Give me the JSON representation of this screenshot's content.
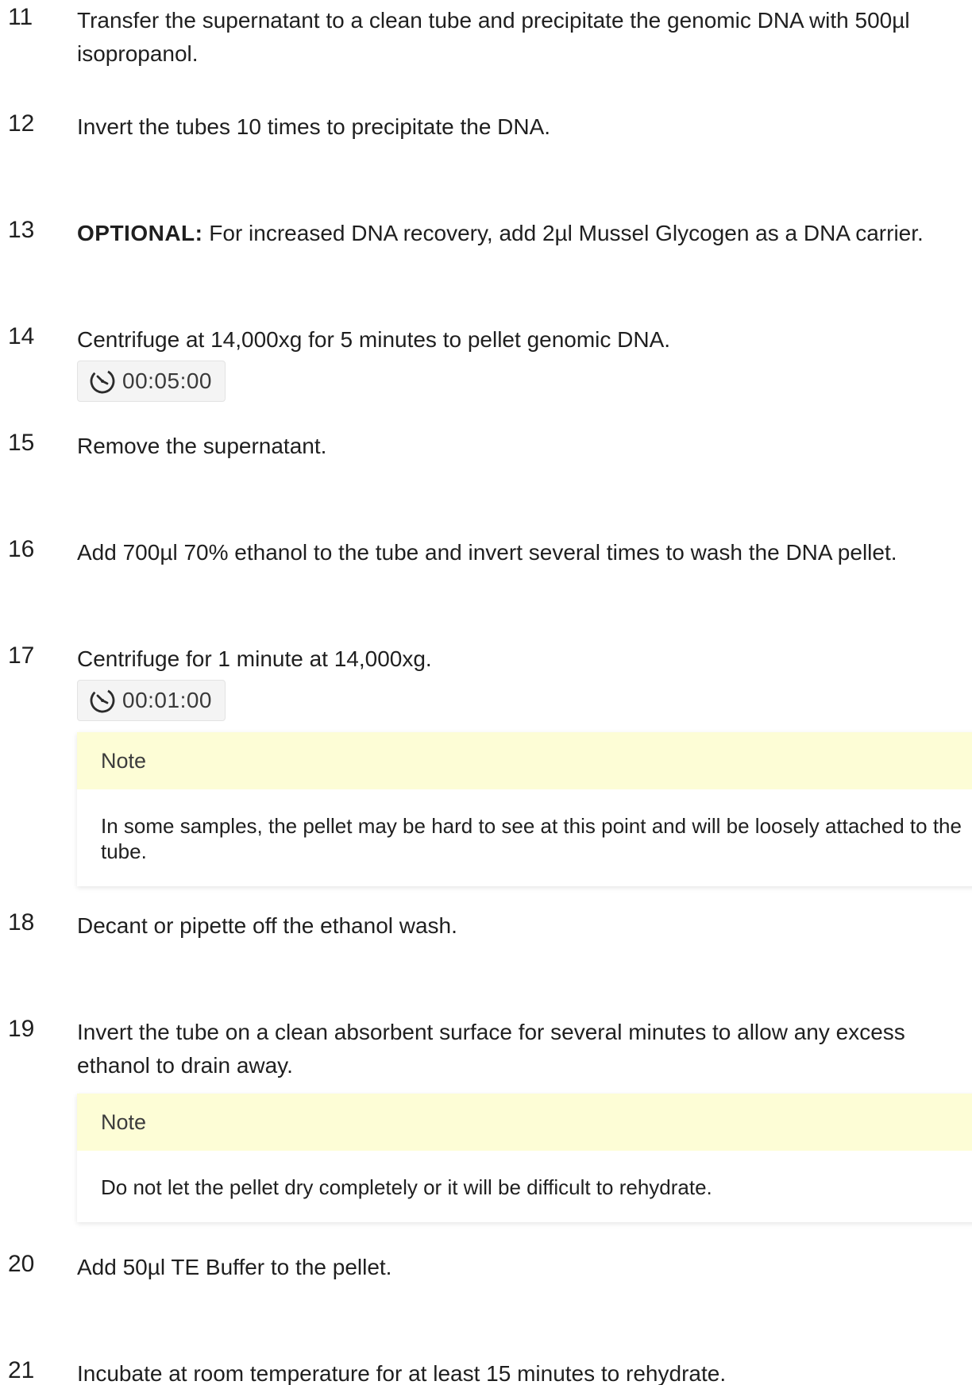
{
  "steps": [
    {
      "number": "11",
      "text": "Transfer the supernatant to a clean tube and precipitate the genomic DNA with 500µl isopropanol."
    },
    {
      "number": "12",
      "text": "Invert the tubes 10 times to precipitate the DNA."
    },
    {
      "number": "13",
      "bold_prefix": "OPTIONAL:",
      "text": " For increased DNA recovery, add 2µl Mussel Glycogen as a DNA carrier."
    },
    {
      "number": "14",
      "text": "Centrifuge at 14,000xg for 5 minutes to pellet genomic DNA.",
      "timer": "00:05:00"
    },
    {
      "number": "15",
      "text": "Remove the supernatant."
    },
    {
      "number": "16",
      "text": "Add 700µl 70% ethanol to the tube and invert several times to wash the DNA pellet."
    },
    {
      "number": "17",
      "text": "Centrifuge for 1 minute at 14,000xg.",
      "timer": "00:01:00",
      "note": {
        "title": "Note",
        "text": "In some samples, the pellet may be hard to see at this point and will be loosely attached to the tube."
      }
    },
    {
      "number": "18",
      "text": "Decant or pipette off the ethanol wash."
    },
    {
      "number": "19",
      "text": "Invert the tube on a clean absorbent surface for several minutes to allow any excess ethanol to drain away.",
      "note": {
        "title": "Note",
        "text": "Do not let the pellet dry completely or it will be difficult to rehydrate."
      }
    },
    {
      "number": "20",
      "text": "Add 50µl TE Buffer to the pellet."
    },
    {
      "number": "21",
      "text": "Incubate at room temperature for at least 15 minutes to rehydrate."
    }
  ],
  "colors": {
    "note_header_bg": "#fdfdd6",
    "timer_bg": "#f4f4f4",
    "text": "#1f1f1f"
  },
  "icons": {
    "timer": "timer-icon"
  }
}
